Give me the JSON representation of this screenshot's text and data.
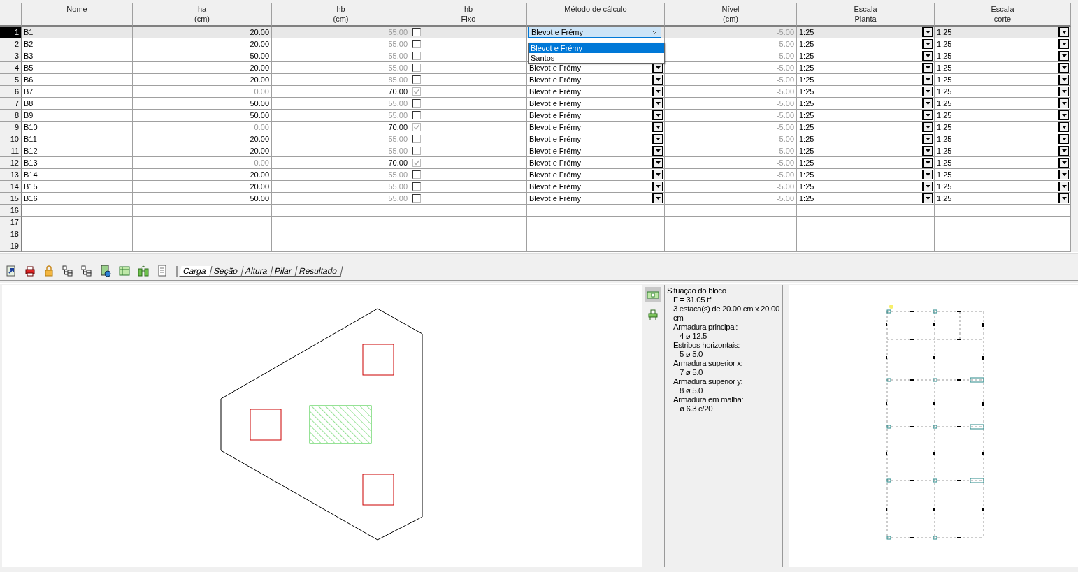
{
  "grid": {
    "columns": [
      {
        "lines": [
          "Nome"
        ]
      },
      {
        "lines": [
          "ha",
          "(cm)"
        ]
      },
      {
        "lines": [
          "hb",
          "(cm)"
        ]
      },
      {
        "lines": [
          "hb",
          "Fixo"
        ]
      },
      {
        "lines": [
          "Método de cálculo"
        ]
      },
      {
        "lines": [
          "Nível",
          "(cm)"
        ]
      },
      {
        "lines": [
          "Escala",
          "Planta"
        ]
      },
      {
        "lines": [
          "Escala",
          "corte"
        ]
      }
    ],
    "rows": [
      {
        "number": "1",
        "name": "B1",
        "ha": "20.00",
        "hb": "55.00",
        "fixed": false,
        "method": "Blevot e Frémy",
        "nivel": "-5.00",
        "scale_plan": "1:25",
        "scale_section": "1:25",
        "selected": true
      },
      {
        "number": "2",
        "name": "B2",
        "ha": "20.00",
        "hb": "55.00",
        "fixed": false,
        "nivel": "-5.00",
        "scale_plan": "1:25",
        "scale_section": "1:25",
        "selected": false
      },
      {
        "number": "3",
        "name": "B3",
        "ha": "50.00",
        "hb": "55.00",
        "fixed": false,
        "nivel": "-5.00",
        "scale_plan": "1:25",
        "scale_section": "1:25",
        "selected": false
      },
      {
        "number": "4",
        "name": "B5",
        "ha": "20.00",
        "hb": "55.00",
        "fixed": false,
        "method": "Blevot e Frémy",
        "nivel": "-5.00",
        "scale_plan": "1:25",
        "scale_section": "1:25",
        "selected": false
      },
      {
        "number": "5",
        "name": "B6",
        "ha": "20.00",
        "hb": "85.00",
        "fixed": false,
        "method": "Blevot e Frémy",
        "nivel": "-5.00",
        "scale_plan": "1:25",
        "scale_section": "1:25",
        "selected": false
      },
      {
        "number": "6",
        "name": "B7",
        "ha": "0.00",
        "hb": "70.00",
        "fixed": true,
        "method": "Blevot e Frémy",
        "nivel": "-5.00",
        "scale_plan": "1:25",
        "scale_section": "1:25",
        "selected": false
      },
      {
        "number": "7",
        "name": "B8",
        "ha": "50.00",
        "hb": "55.00",
        "fixed": false,
        "method": "Blevot e Frémy",
        "nivel": "-5.00",
        "scale_plan": "1:25",
        "scale_section": "1:25",
        "selected": false
      },
      {
        "number": "8",
        "name": "B9",
        "ha": "50.00",
        "hb": "55.00",
        "fixed": false,
        "method": "Blevot e Frémy",
        "nivel": "-5.00",
        "scale_plan": "1:25",
        "scale_section": "1:25",
        "selected": false
      },
      {
        "number": "9",
        "name": "B10",
        "ha": "0.00",
        "hb": "70.00",
        "fixed": true,
        "method": "Blevot e Frémy",
        "nivel": "-5.00",
        "scale_plan": "1:25",
        "scale_section": "1:25",
        "selected": false
      },
      {
        "number": "10",
        "name": "B11",
        "ha": "20.00",
        "hb": "55.00",
        "fixed": false,
        "method": "Blevot e Frémy",
        "nivel": "-5.00",
        "scale_plan": "1:25",
        "scale_section": "1:25",
        "selected": false
      },
      {
        "number": "11",
        "name": "B12",
        "ha": "20.00",
        "hb": "55.00",
        "fixed": false,
        "method": "Blevot e Frémy",
        "nivel": "-5.00",
        "scale_plan": "1:25",
        "scale_section": "1:25",
        "selected": false
      },
      {
        "number": "12",
        "name": "B13",
        "ha": "0.00",
        "hb": "70.00",
        "fixed": true,
        "method": "Blevot e Frémy",
        "nivel": "-5.00",
        "scale_plan": "1:25",
        "scale_section": "1:25",
        "selected": false
      },
      {
        "number": "13",
        "name": "B14",
        "ha": "20.00",
        "hb": "55.00",
        "fixed": false,
        "method": "Blevot e Frémy",
        "nivel": "-5.00",
        "scale_plan": "1:25",
        "scale_section": "1:25",
        "selected": false
      },
      {
        "number": "14",
        "name": "B15",
        "ha": "20.00",
        "hb": "55.00",
        "fixed": false,
        "method": "Blevot e Frémy",
        "nivel": "-5.00",
        "scale_plan": "1:25",
        "scale_section": "1:25",
        "selected": false
      },
      {
        "number": "15",
        "name": "B16",
        "ha": "50.00",
        "hb": "55.00",
        "fixed": false,
        "method": "Blevot e Frémy",
        "nivel": "-5.00",
        "scale_plan": "1:25",
        "scale_section": "1:25",
        "selected": false
      },
      {
        "number": "16",
        "selected": false
      },
      {
        "number": "17",
        "selected": false
      },
      {
        "number": "18",
        "selected": false
      },
      {
        "number": "19",
        "selected": false
      }
    ],
    "dropdown": {
      "options": [
        {
          "label": "Blevot e Frémy",
          "selected": true
        },
        {
          "label": "Santos",
          "selected": false
        }
      ]
    }
  },
  "toolbar": {
    "tools": [
      {
        "kind": "refresh"
      },
      {
        "kind": "printer"
      },
      {
        "kind": "lock"
      },
      {
        "kind": "tree"
      },
      {
        "kind": "tree"
      },
      {
        "kind": "globe"
      },
      {
        "kind": "table"
      },
      {
        "kind": "binoculars"
      },
      {
        "kind": "document"
      }
    ],
    "tabs": [
      {
        "label": "Carga",
        "selected": true
      },
      {
        "label": "Seção",
        "selected": false
      },
      {
        "label": "Altura",
        "selected": false
      },
      {
        "label": "Pilar",
        "selected": false
      },
      {
        "label": "Resultado",
        "selected": false
      }
    ]
  },
  "side_tools": [
    {
      "kind": "banknote",
      "selected": true
    },
    {
      "kind": "printer",
      "selected": false
    }
  ],
  "report": [
    {
      "text": "Situação do bloco",
      "children": [
        {
          "text": "F = 31.05 tf"
        },
        {
          "text": "3 estaca(s) de 20.00 cm x 20.00 cm"
        },
        {
          "text": "Armadura principal:",
          "children": [
            {
              "text": "4 ø 12.5"
            }
          ]
        },
        {
          "text": "Estribos horizontais:",
          "children": [
            {
              "text": "5 ø 5.0"
            }
          ]
        },
        {
          "text": "Armadura superior x:",
          "children": [
            {
              "text": "7 ø 5.0"
            }
          ]
        },
        {
          "text": "Armadura superior y:",
          "children": [
            {
              "text": "8 ø 5.0"
            }
          ]
        },
        {
          "text": "Armadura em malha:",
          "children": [
            {
              "text": " ø 6.3 c/20"
            }
          ]
        }
      ]
    }
  ]
}
